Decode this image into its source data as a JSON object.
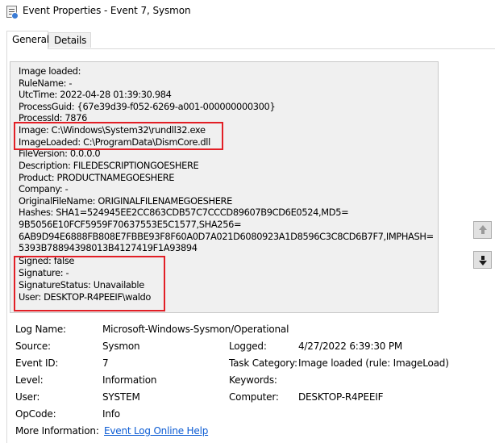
{
  "window": {
    "title": "Event Properties - Event 7, Sysmon",
    "icon": "event-viewer-icon"
  },
  "tabs": [
    {
      "label": "General",
      "active": true
    },
    {
      "label": "Details",
      "active": false
    }
  ],
  "message": {
    "lines": [
      "Image loaded:",
      "RuleName: -",
      "UtcTime: 2022-04-28 01:39:30.984",
      "ProcessGuid: {67e39d39-f052-6269-a001-000000000300}",
      "ProcessId: 7876",
      "Image: C:\\Windows\\System32\\rundll32.exe",
      "ImageLoaded: C:\\ProgramData\\DismCore.dll",
      "FileVersion: 0.0.0.0",
      "Description: FILEDESCRIPTIONGOESHERE",
      "Product: PRODUCTNAMEGOESHERE",
      "Company: -",
      "OriginalFileName: ORIGINALFILENAMEGOESHERE",
      "Hashes: SHA1=524945EE2CC863CDB57C7CCCD89607B9CD6E0524,MD5=",
      "9B5056E10FCF5959F70637553E5C1577,SHA256=",
      "6AB9D94E6888FB808E7FBBE93F8F60A0D7A021D6080923A1D8596C3C8CD6B7F7,IMPHASH=",
      "5393B78894398013B4127419F1A93894",
      "Signed: false",
      "Signature: -",
      "SignatureStatus: Unavailable",
      "User: DESKTOP-R4PEEIF\\waldo"
    ],
    "highlight_color": "#e21f26"
  },
  "nav_buttons": {
    "up_icon": "arrow-up-icon",
    "down_icon": "arrow-down-icon"
  },
  "fields": {
    "log_name": {
      "label": "Log Name:",
      "value": "Microsoft-Windows-Sysmon/Operational"
    },
    "source": {
      "label": "Source:",
      "value": "Sysmon"
    },
    "logged": {
      "label": "Logged:",
      "value": "4/27/2022 6:39:30 PM"
    },
    "event_id": {
      "label": "Event ID:",
      "value": "7"
    },
    "task_category": {
      "label": "Task Category:",
      "value": "Image loaded (rule: ImageLoad)"
    },
    "level": {
      "label": "Level:",
      "value": "Information"
    },
    "keywords": {
      "label": "Keywords:",
      "value": ""
    },
    "user": {
      "label": "User:",
      "value": "SYSTEM"
    },
    "computer": {
      "label": "Computer:",
      "value": "DESKTOP-R4PEEIF"
    },
    "opcode": {
      "label": "OpCode:",
      "value": "Info"
    },
    "more_info": {
      "label": "More Information:",
      "value": "Event Log Online Help"
    }
  },
  "colors": {
    "link": "#0b5bd3",
    "highlight": "#e21f26",
    "text_area_bg": "#f0f0f0"
  }
}
